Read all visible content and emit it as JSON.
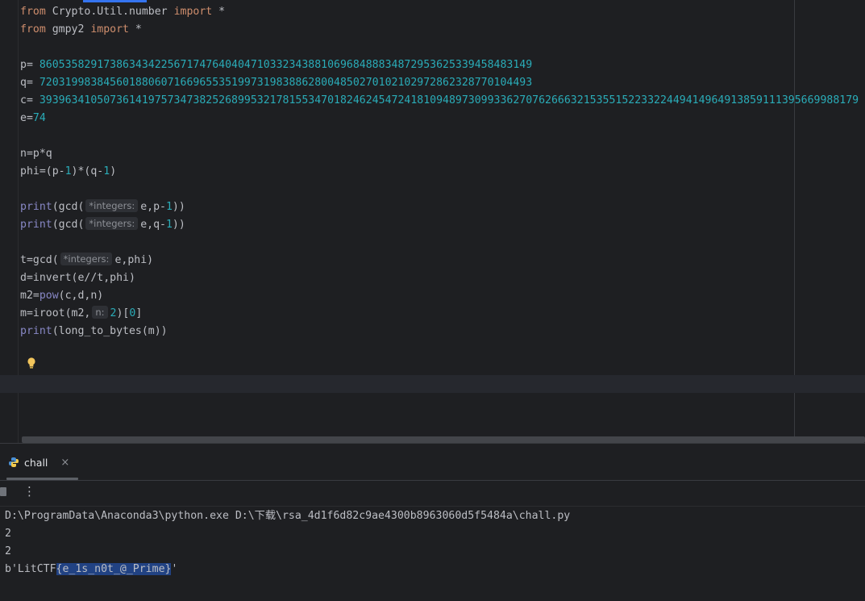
{
  "editor": {
    "lines": {
      "l1": [
        "from",
        " Crypto.Util.number ",
        "import",
        " *"
      ],
      "l2": [
        "from",
        " gmpy2 ",
        "import",
        " *"
      ],
      "p": [
        "p= ",
        "86053582917386343422567174764040471033234388106968488834872953625339458483149"
      ],
      "q": [
        "q= ",
        "72031998384560188060716696553519973198388628004850270102102972862328770104493"
      ],
      "c": [
        "c= ",
        "39396341050736141975734738252689953217815534701824624547241810948973099336270762666321535515223322449414964913859111395669988179"
      ],
      "e": [
        "e=",
        "74"
      ],
      "n": "n=p*q",
      "phi": [
        "phi=(p-",
        "1",
        ")*(q-",
        "1",
        ")"
      ],
      "print1": [
        "print",
        "(gcd(",
        "*integers:",
        "e,p-",
        "1",
        "))"
      ],
      "print2": [
        "print",
        "(gcd(",
        "*integers:",
        "e,q-",
        "1",
        "))"
      ],
      "t": [
        "t=gcd(",
        "*integers:",
        "e,phi)"
      ],
      "d": "d=invert(e//t,phi)",
      "m2": [
        "m2=",
        "pow",
        "(c,d,n)"
      ],
      "m": [
        "m=iroot(m2,",
        "n:",
        "2",
        ")[",
        "0",
        "]"
      ],
      "print3": [
        "print",
        "(long_to_bytes(m))"
      ]
    }
  },
  "run": {
    "tab_label": "chall",
    "close_glyph": "×",
    "more_glyph": "⋮",
    "console": {
      "cmd": "D:\\ProgramData\\Anaconda3\\python.exe D:\\下载\\rsa_4d1f6d82c9ae4300b8963060d5f5484a\\chall.py",
      "out1": "2",
      "out2": "2",
      "flag_prefix": "b'LitCTF",
      "flag_selected": "{e_1s_n0t_@_Prime}",
      "flag_suffix": "'"
    }
  },
  "colors": {
    "keyword": "#cf8e6d",
    "number": "#2aacb8",
    "builtin": "#8888c6",
    "selection": "#214283"
  }
}
